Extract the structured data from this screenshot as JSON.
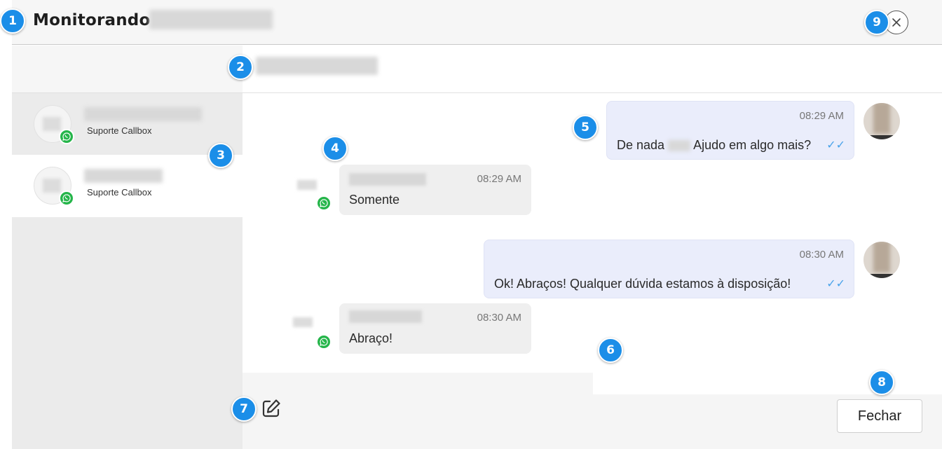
{
  "header": {
    "title": "Monitorando"
  },
  "contacts": [
    {
      "subtitle": "Suporte Callbox"
    },
    {
      "subtitle": "Suporte Callbox"
    }
  ],
  "messages": [
    {
      "direction": "out",
      "time": "08:29 AM",
      "text_a": "De nada",
      "text_b": "Ajudo em algo mais?"
    },
    {
      "direction": "in",
      "time": "08:29 AM",
      "text": "Somente"
    },
    {
      "direction": "out",
      "time": "08:30 AM",
      "text": "Ok! Abraços! Qualquer dúvida estamos à disposição!"
    },
    {
      "direction": "in",
      "time": "08:30 AM",
      "text": "Abraço!"
    }
  ],
  "footer": {
    "close_label": "Fechar"
  },
  "markers": [
    "1",
    "2",
    "3",
    "4",
    "5",
    "6",
    "7",
    "8",
    "9"
  ],
  "colors": {
    "marker": "#1b8ee8",
    "whatsapp": "#25b54a",
    "outgoing_bubble": "#eaedfb",
    "incoming_bubble": "#efefef",
    "read_check": "#4aa3ea"
  },
  "icons": {
    "close": "close-icon",
    "whatsapp": "whatsapp-icon",
    "edit": "edit-icon",
    "check": "double-check-icon"
  }
}
